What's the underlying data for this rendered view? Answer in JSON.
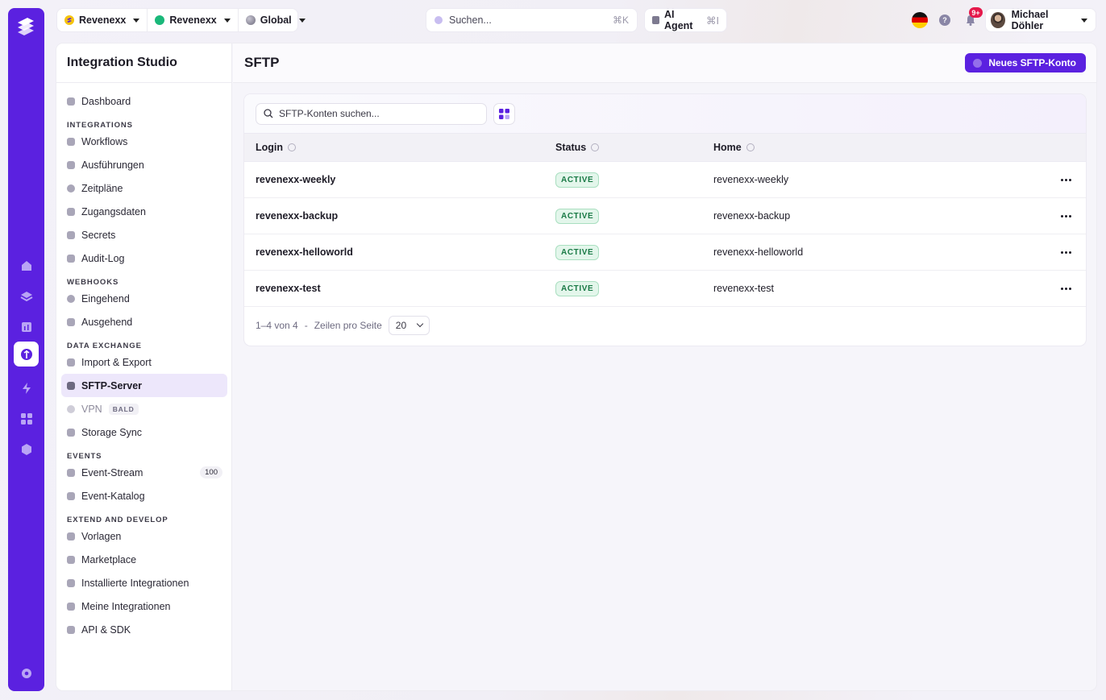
{
  "topbar": {
    "scopes": [
      {
        "label": "Revenexx",
        "icon": "app-logo-icon"
      },
      {
        "label": "Revenexx",
        "icon": "green-dot-icon"
      },
      {
        "label": "Global",
        "icon": "globe-icon"
      }
    ],
    "search_placeholder": "Suchen...",
    "search_shortcut": "⌘K",
    "ai_label": "AI Agent",
    "ai_shortcut": "⌘I",
    "notification_count": "9+",
    "user_name": "Michael Döhler",
    "language_flag": "de-flag-icon"
  },
  "rail": {
    "items": [
      "home-icon",
      "layers-icon",
      "chart-icon",
      "integration-icon",
      "bolt-icon",
      "apps-icon",
      "cube-icon",
      "settings-icon"
    ]
  },
  "sidebar": {
    "title": "Integration Studio",
    "dashboard": "Dashboard",
    "sections": [
      {
        "heading": "INTEGRATIONS",
        "items": [
          {
            "label": "Workflows"
          },
          {
            "label": "Ausführungen"
          },
          {
            "label": "Zeitpläne"
          },
          {
            "label": "Zugangsdaten"
          },
          {
            "label": "Secrets"
          },
          {
            "label": "Audit-Log"
          }
        ]
      },
      {
        "heading": "WEBHOOKS",
        "items": [
          {
            "label": "Eingehend"
          },
          {
            "label": "Ausgehend"
          }
        ]
      },
      {
        "heading": "DATA EXCHANGE",
        "items": [
          {
            "label": "Import & Export"
          },
          {
            "label": "SFTP-Server"
          },
          {
            "label": "VPN"
          },
          {
            "label": "Storage Sync"
          }
        ]
      },
      {
        "heading": "EVENTS",
        "items": [
          {
            "label": "Event-Stream"
          },
          {
            "label": "Event-Katalog"
          }
        ]
      },
      {
        "heading": "EXTEND AND DEVELOP",
        "items": [
          {
            "label": "Vorlagen"
          },
          {
            "label": "Marketplace"
          },
          {
            "label": "Installierte Integrationen"
          },
          {
            "label": "Meine Integrationen"
          },
          {
            "label": "API & SDK"
          }
        ]
      }
    ],
    "vpn_soon": "BALD",
    "event_count": "100"
  },
  "main": {
    "title": "SFTP",
    "new_button": "Neues SFTP-Konto",
    "table_search_placeholder": "SFTP-Konten suchen...",
    "columns": [
      "Login",
      "Status",
      "Home"
    ],
    "rows": [
      {
        "login": "revenexx-weekly",
        "status": "ACTIVE",
        "home": "revenexx-weekly"
      },
      {
        "login": "revenexx-backup",
        "status": "ACTIVE",
        "home": "revenexx-backup"
      },
      {
        "login": "revenexx-helloworld",
        "status": "ACTIVE",
        "home": "revenexx-helloworld"
      },
      {
        "login": "revenexx-test",
        "status": "ACTIVE",
        "home": "revenexx-test"
      }
    ],
    "pagination": {
      "range": "1–4 von 4",
      "separator": "-",
      "rows_label": "Zeilen pro Seite",
      "rows_value": "20"
    }
  },
  "colors": {
    "accent": "#5b21e0",
    "active_status": "#1a7a46",
    "notification": "#e5184a"
  }
}
